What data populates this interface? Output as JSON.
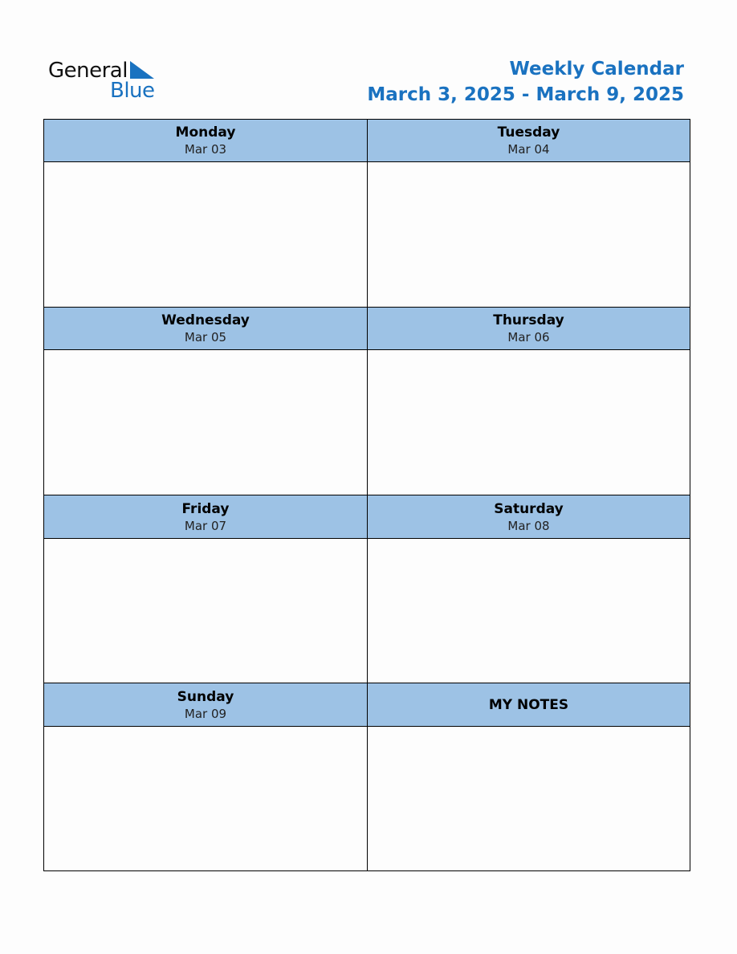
{
  "logo": {
    "word1": "General",
    "word2": "Blue",
    "brand_color": "#1a72c0"
  },
  "header": {
    "title": "Weekly Calendar",
    "date_range": "March 3, 2025 - March 9, 2025",
    "title_color": "#1a72c0"
  },
  "header_fill_color": "#9dc2e5",
  "days": [
    {
      "name": "Monday",
      "date": "Mar 03"
    },
    {
      "name": "Tuesday",
      "date": "Mar 04"
    },
    {
      "name": "Wednesday",
      "date": "Mar 05"
    },
    {
      "name": "Thursday",
      "date": "Mar 06"
    },
    {
      "name": "Friday",
      "date": "Mar 07"
    },
    {
      "name": "Saturday",
      "date": "Mar 08"
    },
    {
      "name": "Sunday",
      "date": "Mar 09"
    }
  ],
  "notes": {
    "title": "MY NOTES"
  }
}
